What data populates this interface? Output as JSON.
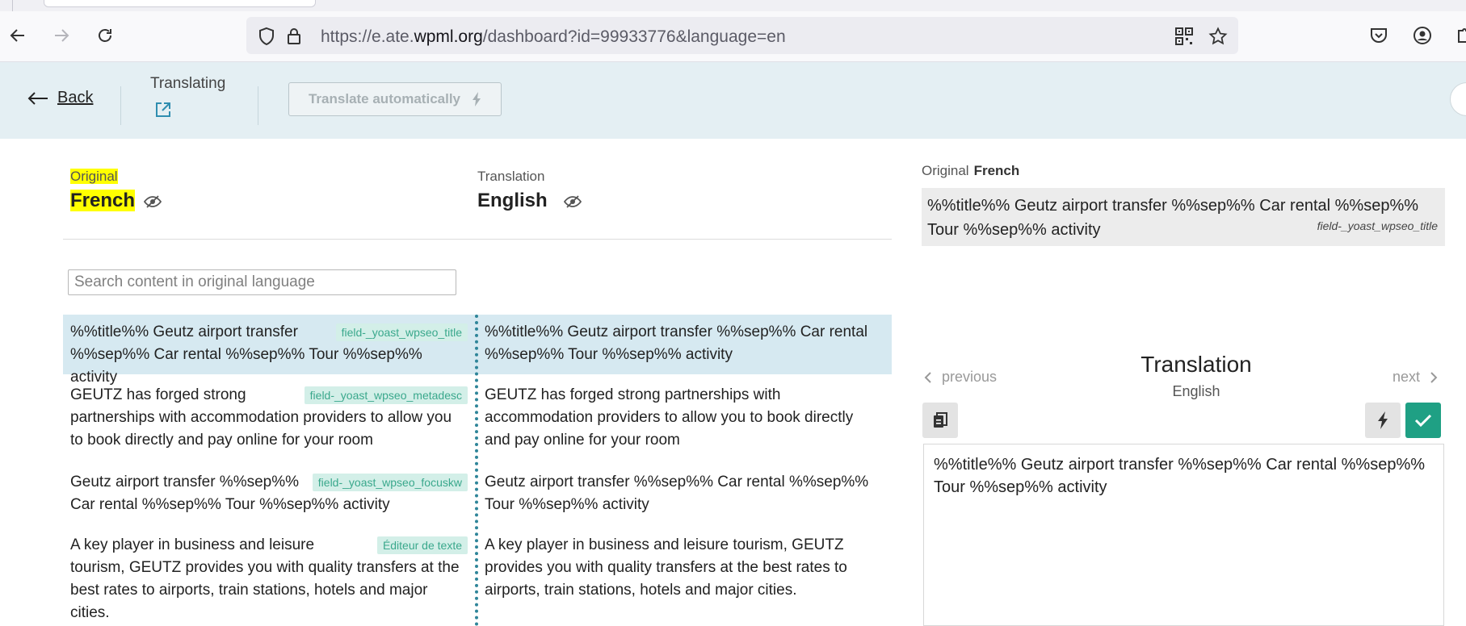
{
  "browser": {
    "url_prefix": "https://e.ate.",
    "url_domain": "wpml.org",
    "url_path": "/dashboard?id=99933776&language=en"
  },
  "header": {
    "back_label": "Back",
    "translating_label": "Translating",
    "auto_translate_label": "Translate automatically"
  },
  "left": {
    "original_label": "Original",
    "original_lang": "French",
    "translation_label": "Translation",
    "translation_lang": "English",
    "search_placeholder": "Search content in original language",
    "segments": [
      {
        "tag": "field-_yoast_wpseo_title",
        "original": "%%title%% Geutz airport transfer %%sep%% Car rental %%sep%% Tour %%sep%% activity",
        "translation": "%%title%% Geutz airport transfer %%sep%% Car rental %%sep%% Tour %%sep%% activity"
      },
      {
        "tag": "field-_yoast_wpseo_metadesc",
        "original": "GEUTZ has forged strong partnerships with accommodation providers to allow you to book directly and pay online for your room",
        "translation": "GEUTZ has forged strong partnerships with accommodation providers to allow you to book directly and pay online for your room"
      },
      {
        "tag": "field-_yoast_wpseo_focuskw",
        "original": "Geutz airport transfer %%sep%% Car rental %%sep%% Tour %%sep%% activity",
        "translation": "Geutz airport transfer %%sep%% Car rental %%sep%% Tour %%sep%% activity"
      },
      {
        "tag": "Éditeur de texte",
        "original": "A key player in business and leisure tourism, GEUTZ provides you with quality transfers at the best rates to airports, train stations, hotels and major cities.",
        "translation": "A key player in business and leisure tourism, GEUTZ provides you with quality transfers at the best rates to airports, train stations, hotels and major cities."
      }
    ]
  },
  "right": {
    "original_label": "Original",
    "original_lang": "French",
    "original_text": "%%title%% Geutz airport transfer %%sep%% Car rental %%sep%% Tour %%sep%% activity",
    "original_tag": "field-_yoast_wpseo_title",
    "previous_label": "previous",
    "next_label": "next",
    "translation_title": "Translation",
    "translation_lang": "English",
    "translation_text": "%%title%% Geutz airport transfer %%sep%% Car rental %%sep%% Tour %%sep%% activity"
  },
  "colors": {
    "accent_teal": "#1fa084",
    "header_bg": "#e4eff3",
    "active_row": "#d6e9f1",
    "highlight": "#ffff00"
  }
}
